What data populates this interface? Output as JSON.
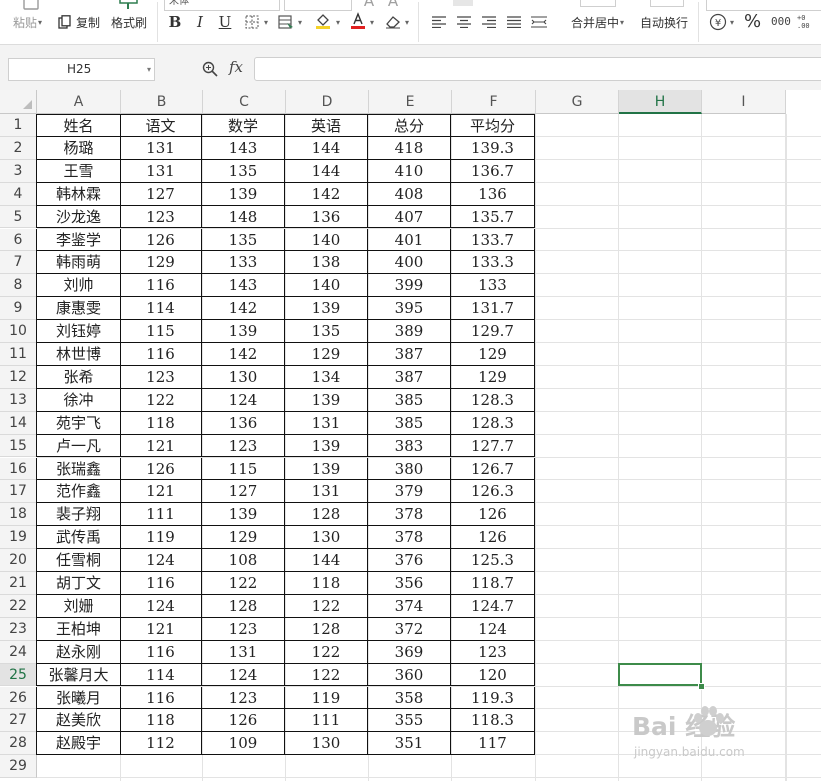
{
  "ribbon": {
    "paste_label": "粘贴",
    "copy_label": "复制",
    "format_painter_label": "格式刷",
    "merge_center_label": "合并居中",
    "wrap_text_label": "自动换行",
    "font_name_visible": "宋体",
    "currency_symbol": "¥",
    "percent_symbol": "%",
    "icons": [
      "paste-icon",
      "copy-icon",
      "format-painter-icon",
      "bold-icon",
      "italic-icon",
      "underline-icon",
      "borders-icon",
      "cell-style-icon",
      "fill-color-icon",
      "font-color-icon",
      "clear-format-icon",
      "align-left-icon",
      "align-center-icon",
      "align-right-icon",
      "justify-icon",
      "distributed-icon",
      "merge-center-icon",
      "wrap-text-icon",
      "currency-icon",
      "percent-icon",
      "thousands-separator-icon"
    ],
    "colors": {
      "fill_accent": "#f5d329",
      "font_accent": "#e02020"
    }
  },
  "formula_bar": {
    "name_box_value": "H25",
    "fx_label": "fx",
    "formula_value": ""
  },
  "sheet": {
    "columns": [
      "A",
      "B",
      "C",
      "D",
      "E",
      "F",
      "G",
      "H",
      "I"
    ],
    "selected_cell": "H25",
    "header_row": [
      "姓名",
      "语文",
      "数学",
      "英语",
      "总分",
      "平均分"
    ],
    "rows": [
      [
        "杨璐",
        "131",
        "143",
        "144",
        "418",
        "139.3"
      ],
      [
        "王雪",
        "131",
        "135",
        "144",
        "410",
        "136.7"
      ],
      [
        "韩林霖",
        "127",
        "139",
        "142",
        "408",
        "136"
      ],
      [
        "沙龙逸",
        "123",
        "148",
        "136",
        "407",
        "135.7"
      ],
      [
        "李鉴学",
        "126",
        "135",
        "140",
        "401",
        "133.7"
      ],
      [
        "韩雨萌",
        "129",
        "133",
        "138",
        "400",
        "133.3"
      ],
      [
        "刘帅",
        "116",
        "143",
        "140",
        "399",
        "133"
      ],
      [
        "康惠雯",
        "114",
        "142",
        "139",
        "395",
        "131.7"
      ],
      [
        "刘钰婷",
        "115",
        "139",
        "135",
        "389",
        "129.7"
      ],
      [
        "林世博",
        "116",
        "142",
        "129",
        "387",
        "129"
      ],
      [
        "张希",
        "123",
        "130",
        "134",
        "387",
        "129"
      ],
      [
        "徐冲",
        "122",
        "124",
        "139",
        "385",
        "128.3"
      ],
      [
        "苑宇飞",
        "118",
        "136",
        "131",
        "385",
        "128.3"
      ],
      [
        "卢一凡",
        "121",
        "123",
        "139",
        "383",
        "127.7"
      ],
      [
        "张瑞鑫",
        "126",
        "115",
        "139",
        "380",
        "126.7"
      ],
      [
        "范作鑫",
        "121",
        "127",
        "131",
        "379",
        "126.3"
      ],
      [
        "裴子翔",
        "111",
        "139",
        "128",
        "378",
        "126"
      ],
      [
        "武传禹",
        "119",
        "129",
        "130",
        "378",
        "126"
      ],
      [
        "任雪桐",
        "124",
        "108",
        "144",
        "376",
        "125.3"
      ],
      [
        "胡丁文",
        "116",
        "122",
        "118",
        "356",
        "118.7"
      ],
      [
        "刘姗",
        "124",
        "128",
        "122",
        "374",
        "124.7"
      ],
      [
        "王柏坤",
        "121",
        "123",
        "128",
        "372",
        "124"
      ],
      [
        "赵永刚",
        "116",
        "131",
        "122",
        "369",
        "123"
      ],
      [
        "张馨月大",
        "114",
        "124",
        "122",
        "360",
        "120"
      ],
      [
        "张曦月",
        "116",
        "123",
        "119",
        "358",
        "119.3"
      ],
      [
        "赵美欣",
        "118",
        "126",
        "111",
        "355",
        "118.3"
      ],
      [
        "赵殿宇",
        "112",
        "109",
        "130",
        "351",
        "117"
      ]
    ],
    "row_numbers": [
      "1",
      "2",
      "3",
      "4",
      "5",
      "6",
      "7",
      "8",
      "9",
      "10",
      "11",
      "12",
      "13",
      "14",
      "15",
      "16",
      "17",
      "18",
      "19",
      "20",
      "21",
      "22",
      "23",
      "24",
      "25",
      "26",
      "27",
      "28",
      "29"
    ]
  },
  "watermark": {
    "text": "Bai 经验",
    "url": "jingyan.baidu.com"
  }
}
